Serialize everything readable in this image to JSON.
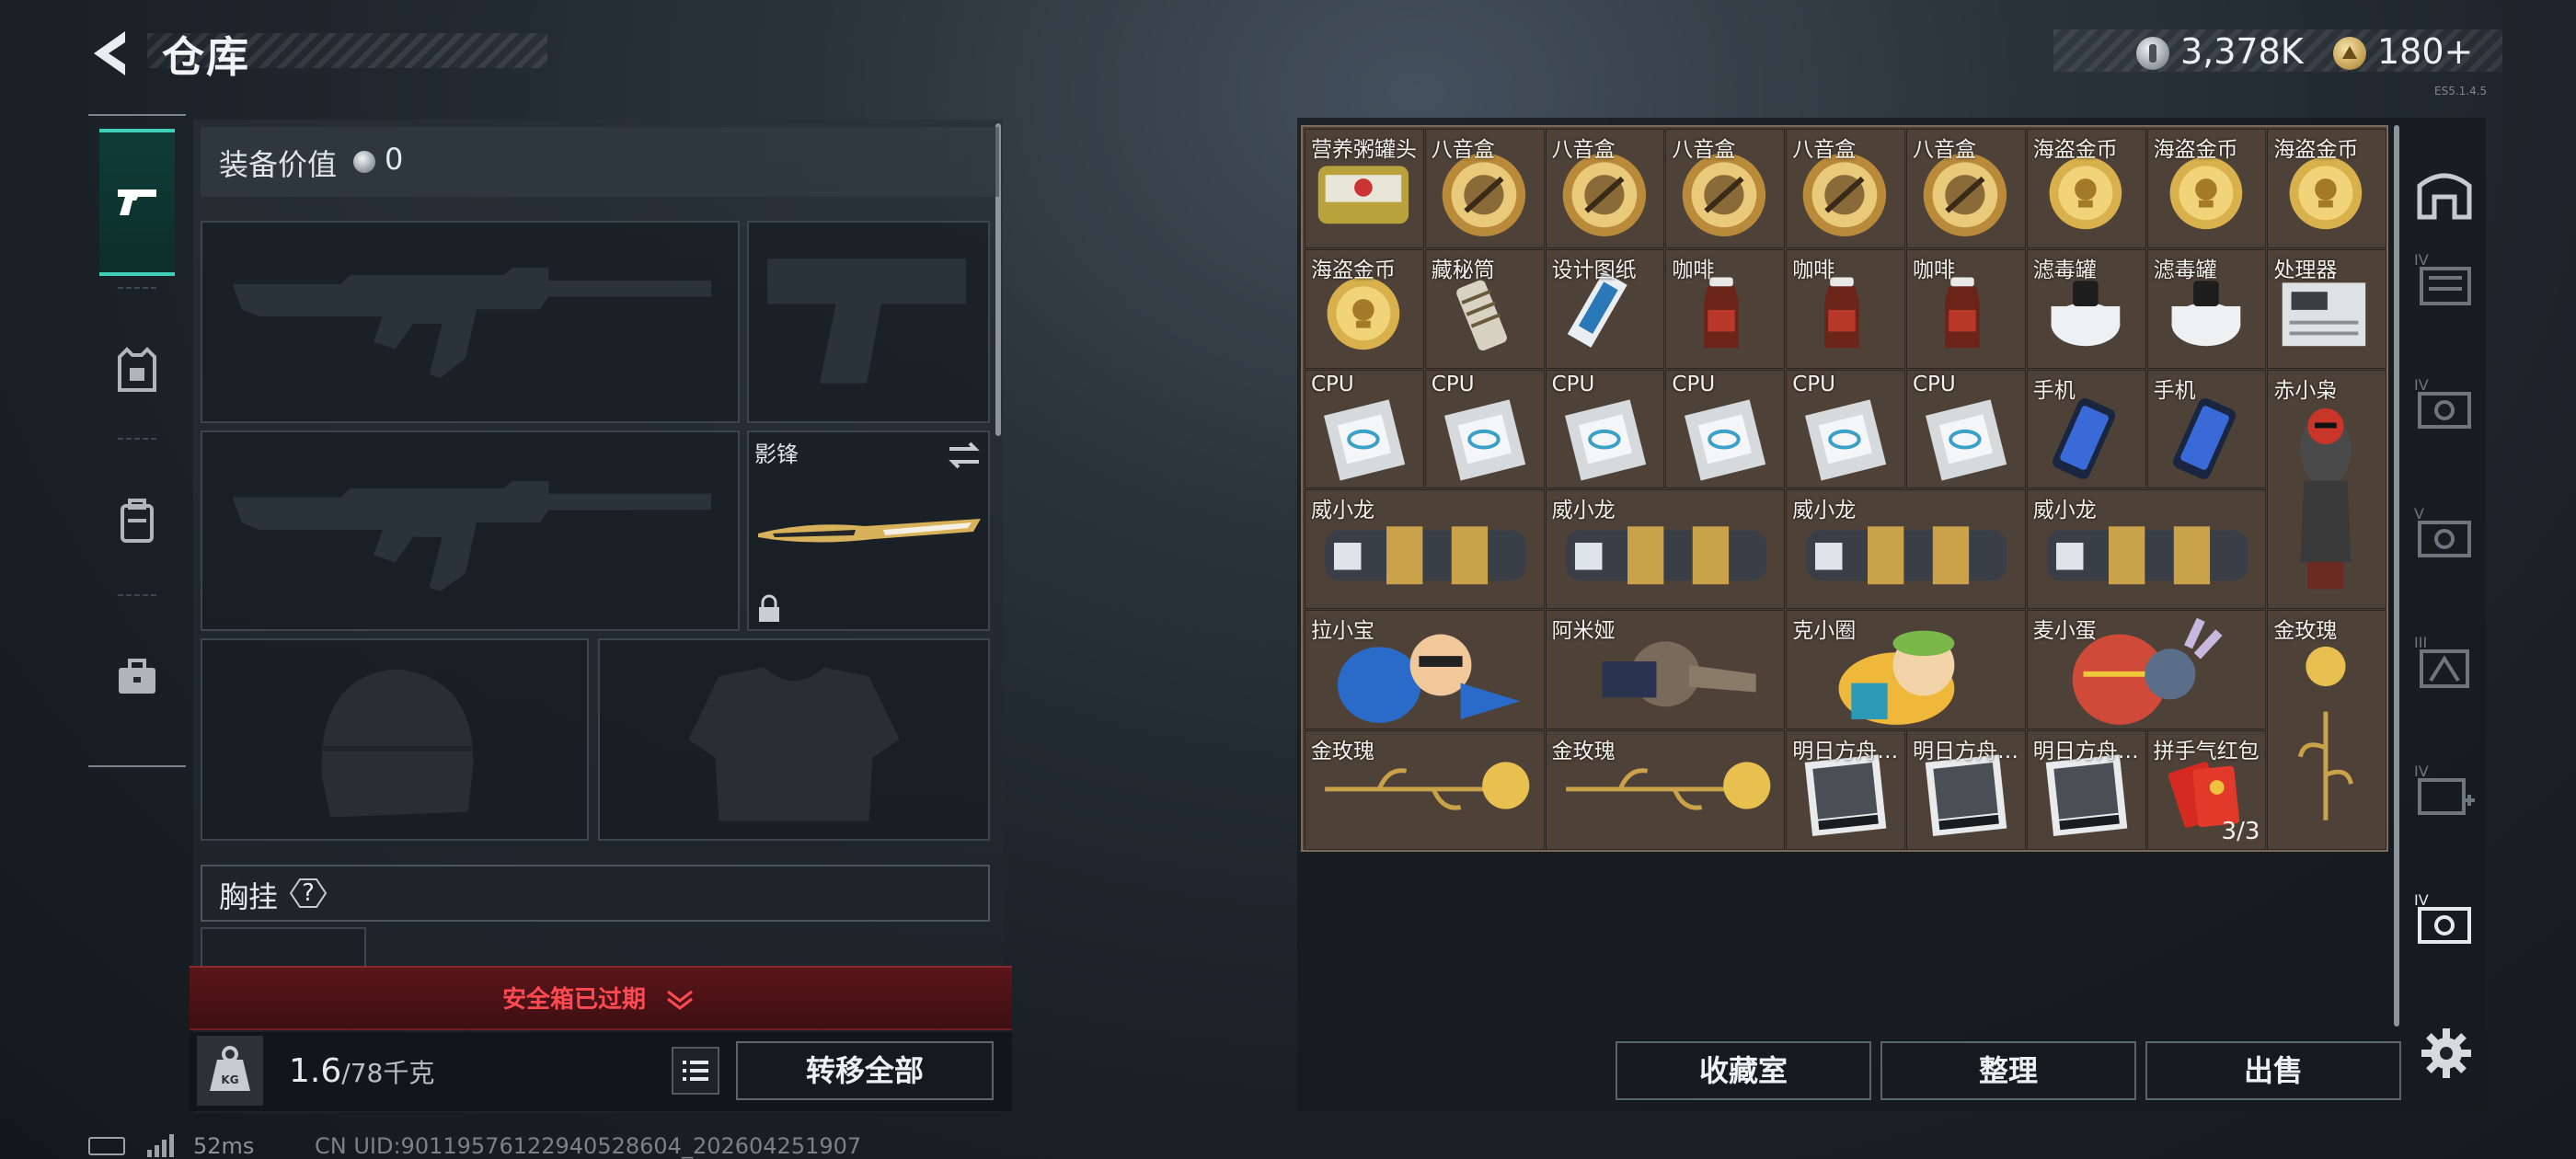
{
  "header": {
    "title": "仓库",
    "money": "3,378K",
    "gold": "180+",
    "version": "ES5.1.4.5"
  },
  "loadout": {
    "equip_value_label": "装备价值",
    "equip_value": "0",
    "melee_label": "影锋",
    "rig_label": "胸挂",
    "rig_help": "?",
    "safe_box_status": "安全箱已过期",
    "weight_current": "1.6",
    "weight_max": "/78千克",
    "transfer_all": "转移全部"
  },
  "status": {
    "ping": "52ms",
    "uid": "CN UID:9011957612294052860​4_202604251907"
  },
  "storage": {
    "items": [
      {
        "name": "营养粥罐头",
        "art": "can"
      },
      {
        "name": "八音盒",
        "art": "musicbox"
      },
      {
        "name": "八音盒",
        "art": "musicbox"
      },
      {
        "name": "八音盒",
        "art": "musicbox"
      },
      {
        "name": "八音盒",
        "art": "musicbox"
      },
      {
        "name": "八音盒",
        "art": "musicbox"
      },
      {
        "name": "海盗金币",
        "art": "coin"
      },
      {
        "name": "海盗金币",
        "art": "coin"
      },
      {
        "name": "海盗金币",
        "art": "coin"
      },
      {
        "name": "海盗金币",
        "art": "coin"
      },
      {
        "name": "藏秘筒",
        "art": "cylinder"
      },
      {
        "name": "设计图纸",
        "art": "blueprint"
      },
      {
        "name": "咖啡",
        "art": "coffee"
      },
      {
        "name": "咖啡",
        "art": "coffee"
      },
      {
        "name": "咖啡",
        "art": "coffee"
      },
      {
        "name": "滤毒罐",
        "art": "filter"
      },
      {
        "name": "滤毒罐",
        "art": "filter"
      },
      {
        "name": "处理器",
        "art": "processor"
      },
      {
        "name": "CPU",
        "art": "cpu"
      },
      {
        "name": "CPU",
        "art": "cpu"
      },
      {
        "name": "CPU",
        "art": "cpu"
      },
      {
        "name": "CPU",
        "art": "cpu"
      },
      {
        "name": "CPU",
        "art": "cpu"
      },
      {
        "name": "CPU",
        "art": "cpu"
      },
      {
        "name": "手机",
        "art": "phone"
      },
      {
        "name": "手机",
        "art": "phone"
      },
      {
        "name": "赤小枭",
        "art": "figure"
      },
      {
        "name": "威小龙",
        "art": "dragon"
      },
      {
        "name": "威小龙",
        "art": "dragon"
      },
      {
        "name": "威小龙",
        "art": "dragon"
      },
      {
        "name": "威小龙",
        "art": "dragon"
      },
      {
        "name": "拉小宝",
        "art": "doll-blue"
      },
      {
        "name": "阿米娅",
        "art": "doll-bunny"
      },
      {
        "name": "克小圈",
        "art": "doll-yellow"
      },
      {
        "name": "麦小蛋",
        "art": "doll-egg"
      },
      {
        "name": "金玫瑰",
        "art": "rose-v"
      },
      {
        "name": "金玫瑰",
        "art": "rose-h"
      },
      {
        "name": "金玫瑰",
        "art": "rose-h"
      },
      {
        "name": "明日方舟…",
        "art": "album"
      },
      {
        "name": "明日方舟…",
        "art": "album"
      },
      {
        "name": "明日方舟…",
        "art": "album"
      },
      {
        "name": "拼手气红包",
        "art": "redpacket",
        "qty": "3/3"
      }
    ]
  },
  "actions": {
    "collection": "收藏室",
    "sort": "整理",
    "sell": "出售"
  },
  "colors": {
    "accent": "#3ed0b6",
    "alert": "#ff4a52",
    "grid": "#4e4238"
  }
}
